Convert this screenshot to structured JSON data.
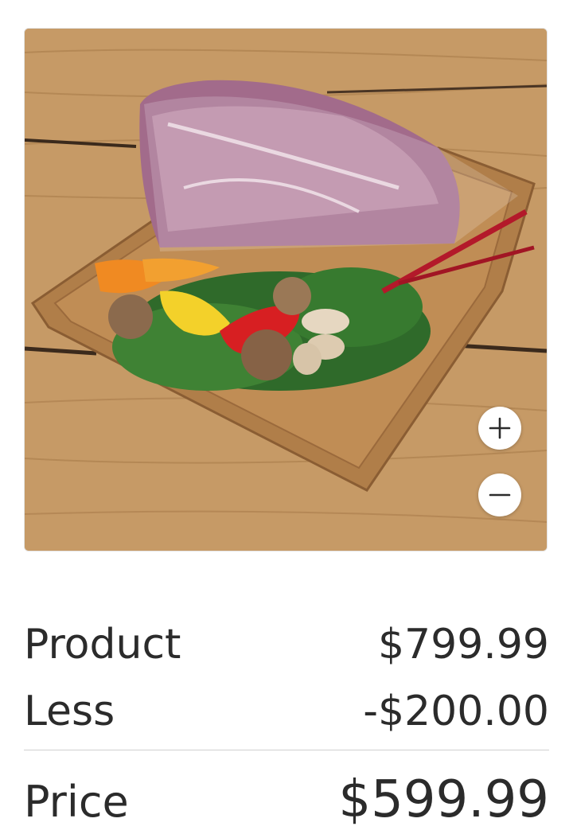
{
  "product_image": {
    "alt": "",
    "zoom_in_icon": "plus-icon",
    "zoom_out_icon": "minus-icon"
  },
  "pricing": {
    "product_label": "Product",
    "product_value": "$799.99",
    "less_label": "Less",
    "less_value": "-$200.00",
    "price_label": "Price",
    "price_value": "$599.99"
  }
}
